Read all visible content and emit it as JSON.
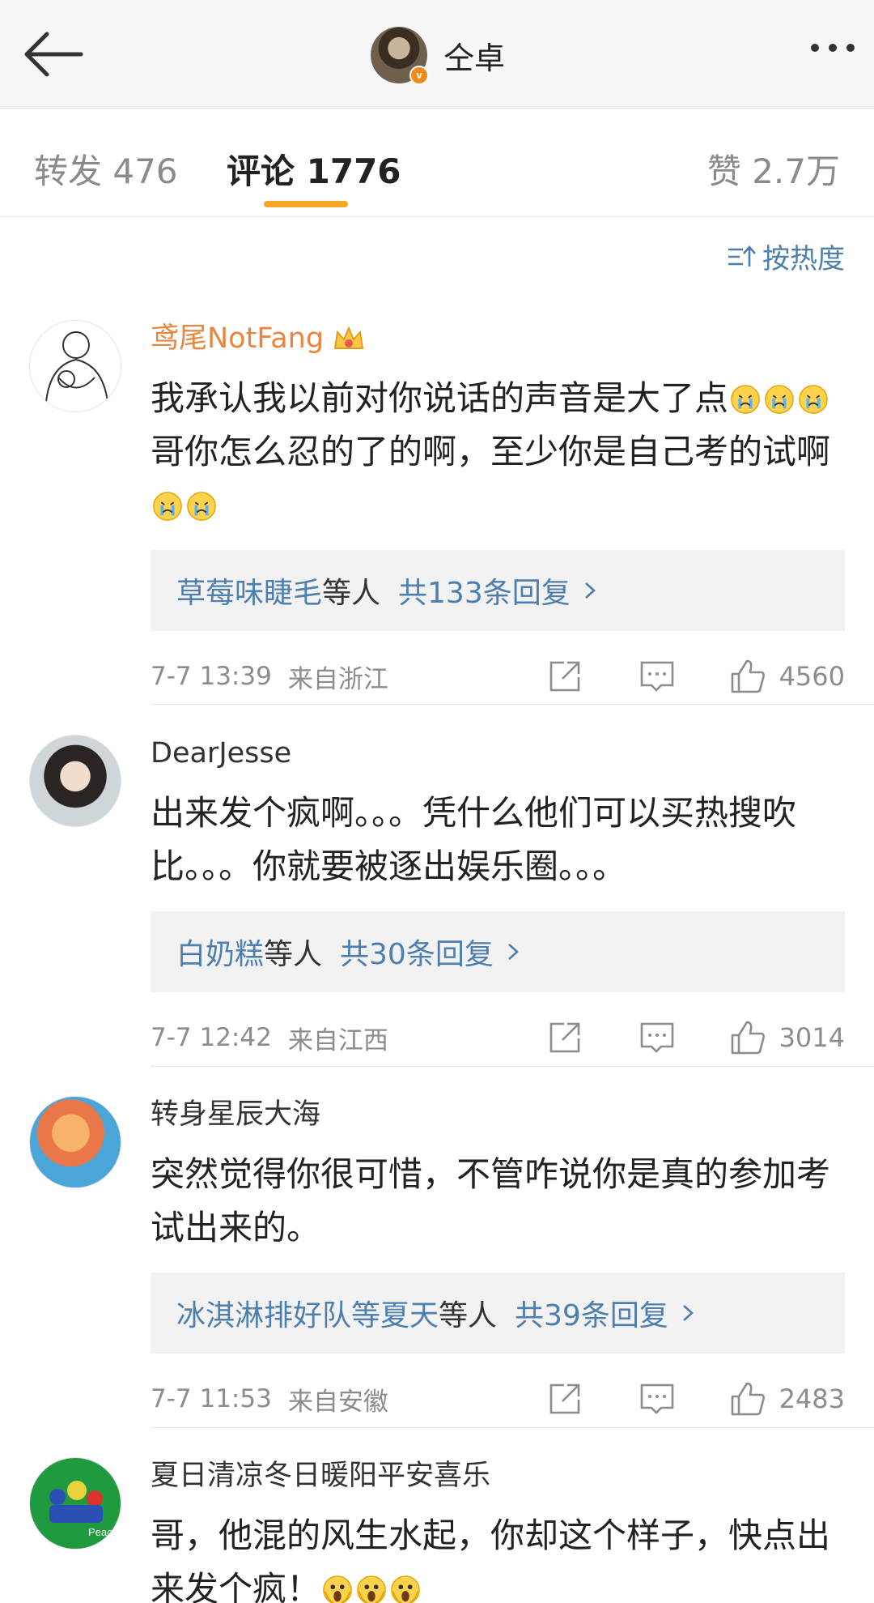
{
  "header": {
    "title": "仝卓",
    "verified_badge": "v"
  },
  "tabs": {
    "forward": "转发 476",
    "comments": "评论 1776",
    "likes": "赞 2.7万",
    "active": "comments"
  },
  "sort": {
    "label": "按热度"
  },
  "comments": [
    {
      "user": "鸢尾NotFang",
      "text_parts": [
        "我承认我以前对你说话的声音是大了点",
        "哥你怎么忍的了的啊，至少你是自己考的试啊"
      ],
      "reply_who": "草莓味睫毛",
      "reply_others": "等人",
      "reply_count": "共133条回复",
      "time": "7-7 13:39",
      "location": "来自浙江",
      "likes": "4560"
    },
    {
      "user": "DearJesse",
      "text": "出来发个疯啊。。。凭什么他们可以买热搜吹比。。。你就要被逐出娱乐圈。。。",
      "reply_who": "白奶糕",
      "reply_others": "等人",
      "reply_count": "共30条回复",
      "time": "7-7 12:42",
      "location": "来自江西",
      "likes": "3014"
    },
    {
      "user": "转身星辰大海",
      "text": "突然觉得你很可惜，不管咋说你是真的参加考试出来的。",
      "reply_who": "冰淇淋排好队等夏天",
      "reply_others": "等人",
      "reply_count": "共39条回复",
      "time": "7-7 11:53",
      "location": "来自安徽",
      "likes": "2483"
    },
    {
      "user": "夏日清凉冬日暖阳平安喜乐",
      "text": "哥，他混的风生水起，你却这个样子，快点出来发个疯！",
      "avatar_text": "Peace"
    }
  ],
  "colors": {
    "accent_orange": "#f5a623",
    "link_blue": "#4d7fae",
    "vip_name": "#e8863e"
  }
}
